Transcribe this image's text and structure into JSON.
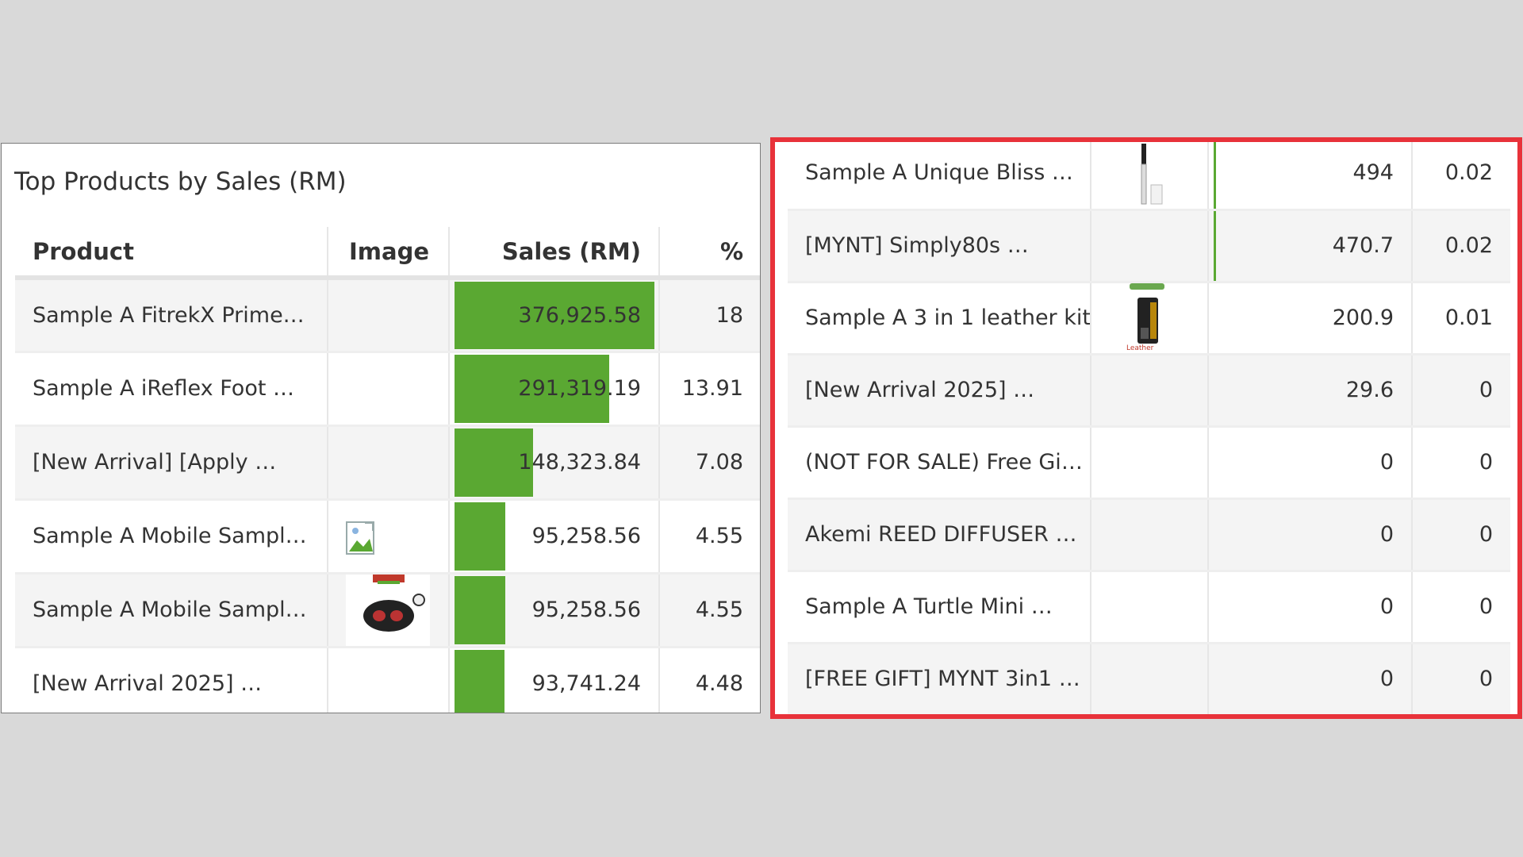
{
  "left": {
    "title": "Top Products by Sales (RM)",
    "columns": {
      "product": "Product",
      "image": "Image",
      "sales": "Sales (RM)",
      "pct": "%"
    },
    "max_sales": 376925.58,
    "rows": [
      {
        "product": "Sample A FitrekX Prime…",
        "sales": "376,925.58",
        "sales_value": 376925.58,
        "pct": "18",
        "image": "none"
      },
      {
        "product": "Sample A iReflex Foot …",
        "sales": "291,319.19",
        "sales_value": 291319.19,
        "pct": "13.91",
        "image": "none"
      },
      {
        "product": "[New Arrival] [Apply …",
        "sales": "148,323.84",
        "sales_value": 148323.84,
        "pct": "7.08",
        "image": "none"
      },
      {
        "product": "Sample A Mobile Sampl…",
        "sales": "95,258.56",
        "sales_value": 95258.56,
        "pct": "4.55",
        "image": "broken-image-icon"
      },
      {
        "product": "Sample A Mobile Sampl…",
        "sales": "95,258.56",
        "sales_value": 95258.56,
        "pct": "4.55",
        "image": "massager-photo"
      },
      {
        "product": "[New Arrival 2025] …",
        "sales": "93,741.24",
        "sales_value": 93741.24,
        "pct": "4.48",
        "image": "none"
      }
    ]
  },
  "right": {
    "rows": [
      {
        "product": "Sample A Unique Bliss …",
        "sales": "494",
        "pct": "0.02",
        "image": "bottle-photo",
        "bar": true
      },
      {
        "product": "[MYNT] Simply80s …",
        "sales": "470.7",
        "pct": "0.02",
        "image": "none",
        "bar": true
      },
      {
        "product": "Sample A 3 in 1 leather kit",
        "sales": "200.9",
        "pct": "0.01",
        "image": "leather-kit-photo",
        "bar": false
      },
      {
        "product": "[New Arrival 2025] …",
        "sales": "29.6",
        "pct": "0",
        "image": "none",
        "bar": false
      },
      {
        "product": "(NOT FOR SALE) Free Gi…",
        "sales": "0",
        "pct": "0",
        "image": "none",
        "bar": false
      },
      {
        "product": "Akemi REED DIFFUSER …",
        "sales": "0",
        "pct": "0",
        "image": "none",
        "bar": false
      },
      {
        "product": "Sample A Turtle Mini …",
        "sales": "0",
        "pct": "0",
        "image": "none",
        "bar": false
      },
      {
        "product": "[FREE GIFT] MYNT 3in1 …",
        "sales": "0",
        "pct": "0",
        "image": "none",
        "bar": false
      }
    ]
  },
  "colors": {
    "bar": "#5aa832",
    "highlight_border": "#e8323a",
    "background": "#d9d9d9"
  }
}
